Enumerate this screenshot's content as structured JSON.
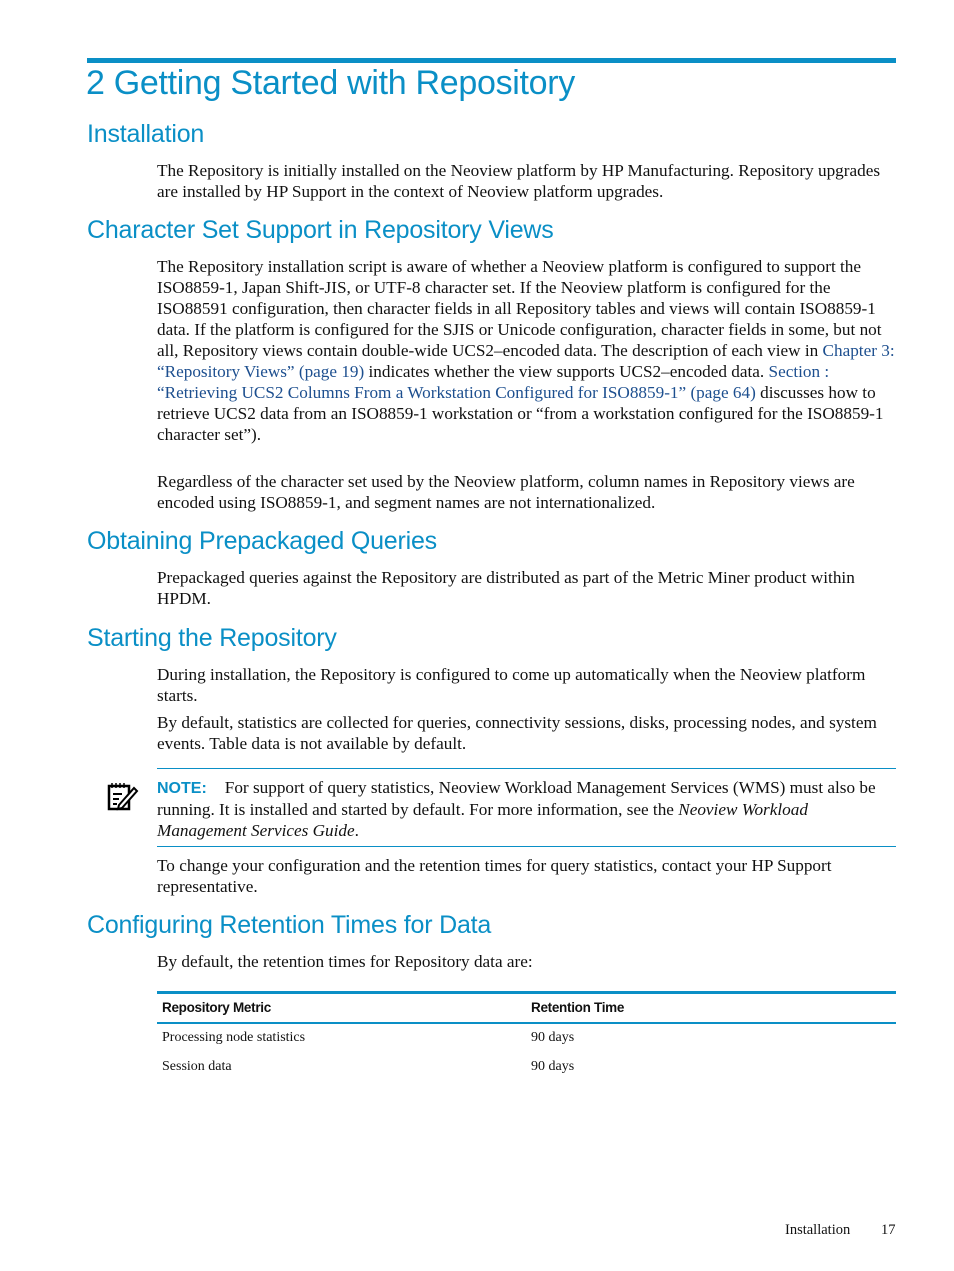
{
  "chapter_title": "2 Getting Started with Repository",
  "sections": {
    "installation": {
      "heading": "Installation",
      "body": "The Repository is initially installed on the Neoview platform by HP Manufacturing. Repository upgrades are installed by HP Support in the context of Neoview platform upgrades."
    },
    "charset": {
      "heading": "Character Set Support in Repository Views",
      "p1_part1": "The Repository installation script is aware of whether a Neoview platform is configured to support the ISO8859-1, Japan Shift-JIS, or UTF-8 character set. If the Neoview platform is configured for the ISO88591 configuration, then character fields in all Repository tables and views will contain ISO8859-1 data. If the platform is configured for the SJIS or Unicode configuration, character fields in some, but not all, Repository views contain double-wide UCS2–encoded data. The description of each view in ",
      "p1_link1": "Chapter 3: “Repository Views” (page 19)",
      "p1_part2": " indicates whether the view supports UCS2–encoded data. ",
      "p1_link2": "Section : “Retrieving UCS2 Columns From a Workstation Configured for ISO8859-1” (page 64)",
      "p1_part3": " discusses how to retrieve UCS2 data from an ISO8859-1 workstation or “from a workstation configured for the ISO8859-1 character set”).",
      "p2": "Regardless of the character set used by the Neoview platform, column names in Repository views are encoded using ISO8859-1, and segment names are not internationalized."
    },
    "prepackaged": {
      "heading": "Obtaining Prepackaged Queries",
      "body": "Prepackaged queries against the Repository are distributed as part of the Metric Miner product within HPDM."
    },
    "starting": {
      "heading": "Starting the Repository",
      "p1": "During installation, the Repository is configured to come up automatically when the Neoview platform starts.",
      "p2": "By default, statistics are collected for queries, connectivity sessions, disks, processing nodes, and system events. Table data is not available by default.",
      "note_label": "NOTE:",
      "note_text": "For support of query statistics, Neoview Workload Management Services (WMS) must also be running. It is installed and started by default. For more information, see the ",
      "note_italic": "Neoview Workload Management Services Guide",
      "note_end": ".",
      "p3": "To change your configuration and the retention times for query statistics, contact your HP Support representative."
    },
    "retention": {
      "heading": "Configuring Retention Times for Data",
      "intro": "By default, the retention times for Repository data are:",
      "table": {
        "headers": [
          "Repository Metric",
          "Retention Time"
        ],
        "rows": [
          [
            "Processing node statistics",
            "90 days"
          ],
          [
            "Session data",
            "90 days"
          ]
        ]
      }
    }
  },
  "footer": {
    "section": "Installation",
    "page": "17"
  },
  "colors": {
    "accent": "#0a8fc6",
    "link": "#1d4f8f"
  }
}
